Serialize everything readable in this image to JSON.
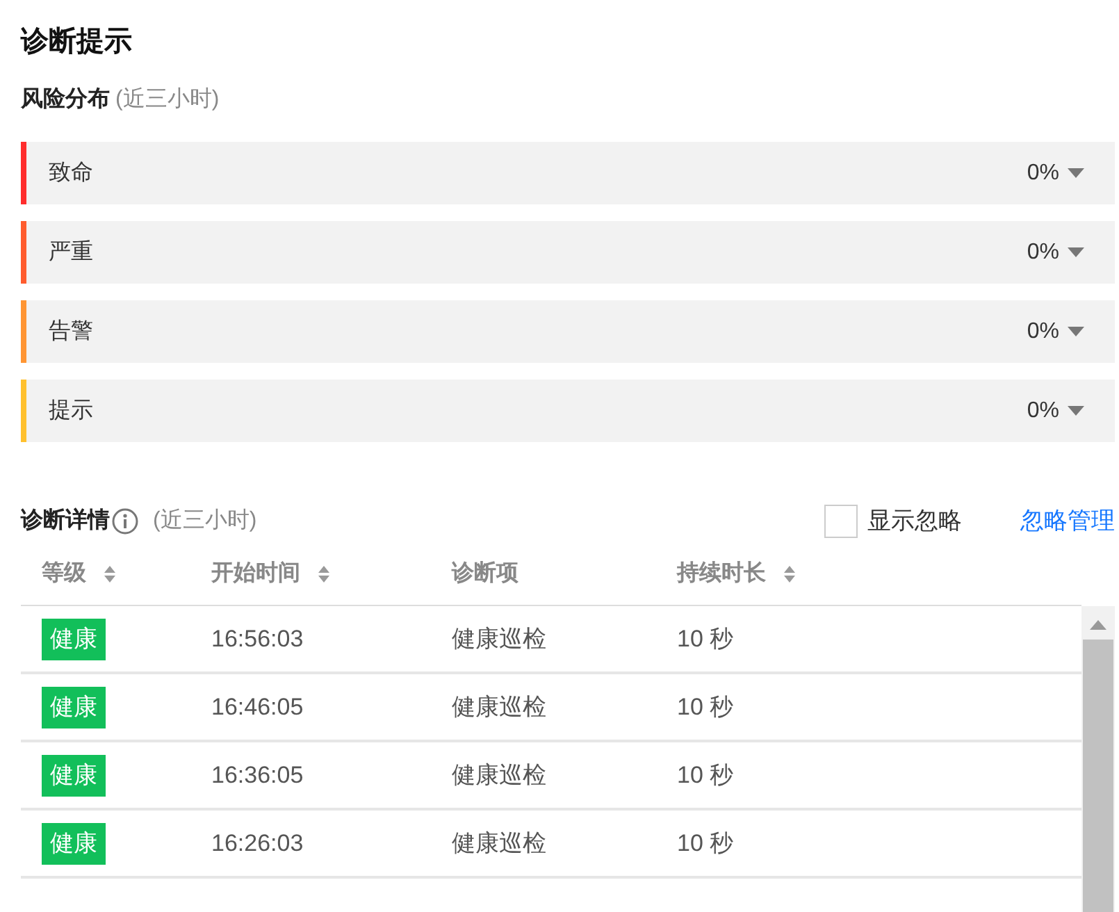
{
  "title": "诊断提示",
  "risk": {
    "heading": "风险分布",
    "period": "(近三小时)",
    "levels": [
      {
        "label": "致命",
        "value": "0%",
        "color": "#ff2d2d"
      },
      {
        "label": "严重",
        "value": "0%",
        "color": "#ff5c2e"
      },
      {
        "label": "告警",
        "value": "0%",
        "color": "#ff9533"
      },
      {
        "label": "提示",
        "value": "0%",
        "color": "#ffc02e"
      }
    ]
  },
  "details": {
    "heading": "诊断详情",
    "period": "(近三小时)",
    "show_ignored": {
      "label": "显示忽略",
      "checked": false
    },
    "manage_link": "忽略管理",
    "columns": [
      {
        "label": "等级",
        "sortable": true
      },
      {
        "label": "开始时间",
        "sortable": true
      },
      {
        "label": "诊断项",
        "sortable": false
      },
      {
        "label": "持续时长",
        "sortable": true
      }
    ],
    "rows": [
      {
        "level": "健康",
        "color": "#12bf5a",
        "start": "16:56:03",
        "item": "健康巡检",
        "duration": "10 秒"
      },
      {
        "level": "健康",
        "color": "#12bf5a",
        "start": "16:46:05",
        "item": "健康巡检",
        "duration": "10 秒"
      },
      {
        "level": "健康",
        "color": "#12bf5a",
        "start": "16:36:05",
        "item": "健康巡检",
        "duration": "10 秒"
      },
      {
        "level": "健康",
        "color": "#12bf5a",
        "start": "16:26:03",
        "item": "健康巡检",
        "duration": "10 秒"
      }
    ]
  }
}
